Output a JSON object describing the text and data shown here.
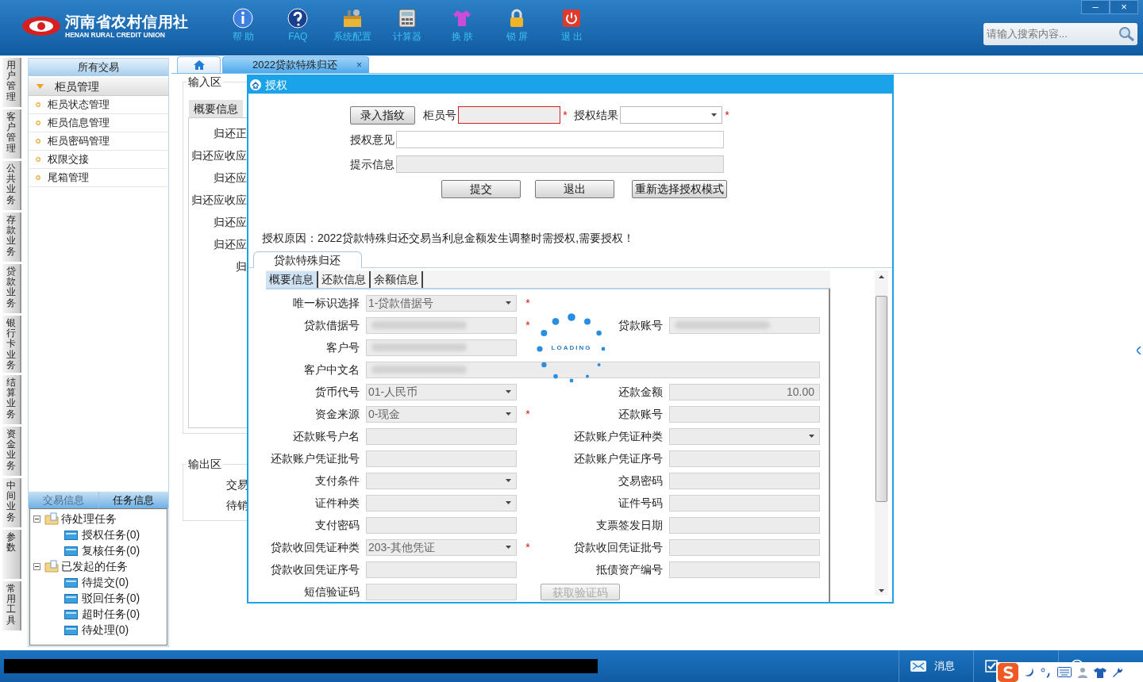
{
  "header": {
    "logo_title": "河南省农村信用社",
    "logo_subtitle": "HENAN RURAL CREDIT UNION",
    "toolbar": [
      {
        "label": "帮 助"
      },
      {
        "label": "FAQ"
      },
      {
        "label": "系统配置"
      },
      {
        "label": "计算器"
      },
      {
        "label": "换 肤"
      },
      {
        "label": "锁 屏"
      },
      {
        "label": "退 出"
      }
    ],
    "window_controls": [
      "–",
      "×"
    ],
    "search": {
      "placeholder": "请输入搜索内容..."
    }
  },
  "side_tabs": [
    "用户管理",
    "客户管理",
    "公共业务",
    "存款业务",
    "贷款业务",
    "银行卡业务",
    "结算业务",
    "资金业务",
    "中间业务",
    "参数",
    "常用工具"
  ],
  "sidebar": {
    "header": "所有交易",
    "groups": [
      {
        "label": "柜员管理",
        "expanded": true,
        "children": [
          "柜员状态管理",
          "柜员信息管理",
          "柜员密码管理",
          "权限交接",
          "尾箱管理"
        ]
      }
    ]
  },
  "task_panel": {
    "tabs": [
      {
        "label": "交易信息",
        "selected": false
      },
      {
        "label": "任务信息",
        "selected": true
      }
    ],
    "tree": [
      {
        "label": "待处理任务",
        "expanded": true,
        "children": [
          "授权任务(0)",
          "复核任务(0)"
        ]
      },
      {
        "label": "已发起的任务",
        "expanded": true,
        "children": [
          "待提交(0)",
          "驳回任务(0)",
          "超时任务(0)",
          "待处理(0)"
        ]
      }
    ]
  },
  "doc_tabs": [
    {
      "kind": "home",
      "selected": false
    },
    {
      "kind": "text",
      "label": "2022贷款特殊归还",
      "close": "×",
      "selected": true
    }
  ],
  "input_area": {
    "legend": "输入区",
    "tab": "概要信息",
    "labels": [
      "归还正",
      "归还应收应",
      "归还应",
      "归还应收应",
      "归还应",
      "归还应",
      "归"
    ]
  },
  "output_area": {
    "legend": "输出区",
    "labels": [
      "交易",
      "待销"
    ]
  },
  "dialog": {
    "title": "授权",
    "fingerprint_button": "录入指纹",
    "required_mark": "*",
    "teller": {
      "label": "柜员号",
      "required": true,
      "error": true
    },
    "result": {
      "label": "授权结果",
      "required": true
    },
    "opinion": {
      "label": "授权意见",
      "disabled": false
    },
    "hint": {
      "label": "提示信息",
      "disabled": true
    },
    "buttons": [
      "提交",
      "退出",
      "重新选择授权模式"
    ],
    "reason": "授权原因：2022贷款特殊归还交易当利息金额发生调整时需授权,需要授权！",
    "section_tab": "贷款特殊归还",
    "inner_tabs": [
      {
        "label": "概要信息",
        "selected": true
      },
      {
        "label": "还款信息",
        "selected": false
      },
      {
        "label": "余额信息",
        "selected": false
      }
    ],
    "loading": "LOADING",
    "rows": [
      [
        {
          "label": "唯一标识选择",
          "kind": "select",
          "value": "1-贷款借据号",
          "required": true
        }
      ],
      [
        {
          "label": "贷款借据号",
          "kind": "text",
          "redacted": true,
          "required": true
        },
        {
          "label": "贷款账号",
          "kind": "text",
          "redacted": true
        }
      ],
      [
        {
          "label": "客户号",
          "kind": "text",
          "redacted": true
        }
      ],
      [
        {
          "label": "客户中文名",
          "kind": "wide",
          "redacted": true
        }
      ],
      [
        {
          "label": "货币代号",
          "kind": "select",
          "value": "01-人民币"
        },
        {
          "label": "还款金额",
          "kind": "text",
          "value": "10.00"
        }
      ],
      [
        {
          "label": "资金来源",
          "kind": "select",
          "value": "0-现金",
          "required": true
        },
        {
          "label": "还款账号",
          "kind": "text"
        }
      ],
      [
        {
          "label": "还款账号户名",
          "kind": "text"
        },
        {
          "label": "还款账户凭证种类",
          "kind": "select"
        }
      ],
      [
        {
          "label": "还款账户凭证批号",
          "kind": "text"
        },
        {
          "label": "还款账户凭证序号",
          "kind": "text"
        }
      ],
      [
        {
          "label": "支付条件",
          "kind": "select"
        },
        {
          "label": "交易密码",
          "kind": "text"
        }
      ],
      [
        {
          "label": "证件种类",
          "kind": "select"
        },
        {
          "label": "证件号码",
          "kind": "text"
        }
      ],
      [
        {
          "label": "支付密码",
          "kind": "text"
        },
        {
          "label": "支票签发日期",
          "kind": "text"
        }
      ],
      [
        {
          "label": "贷款收回凭证种类",
          "kind": "select",
          "value": "203-其他凭证",
          "required": true
        },
        {
          "label": "贷款收回凭证批号",
          "kind": "text"
        }
      ],
      [
        {
          "label": "贷款收回凭证序号",
          "kind": "text"
        },
        {
          "label": "抵债资产编号",
          "kind": "text"
        }
      ],
      [
        {
          "label": "短信验证码",
          "kind": "text"
        },
        {
          "kind": "button",
          "label": "获取验证码",
          "disabled": true
        }
      ]
    ]
  },
  "status_bar": {
    "items": [
      {
        "label": "消息"
      }
    ]
  }
}
